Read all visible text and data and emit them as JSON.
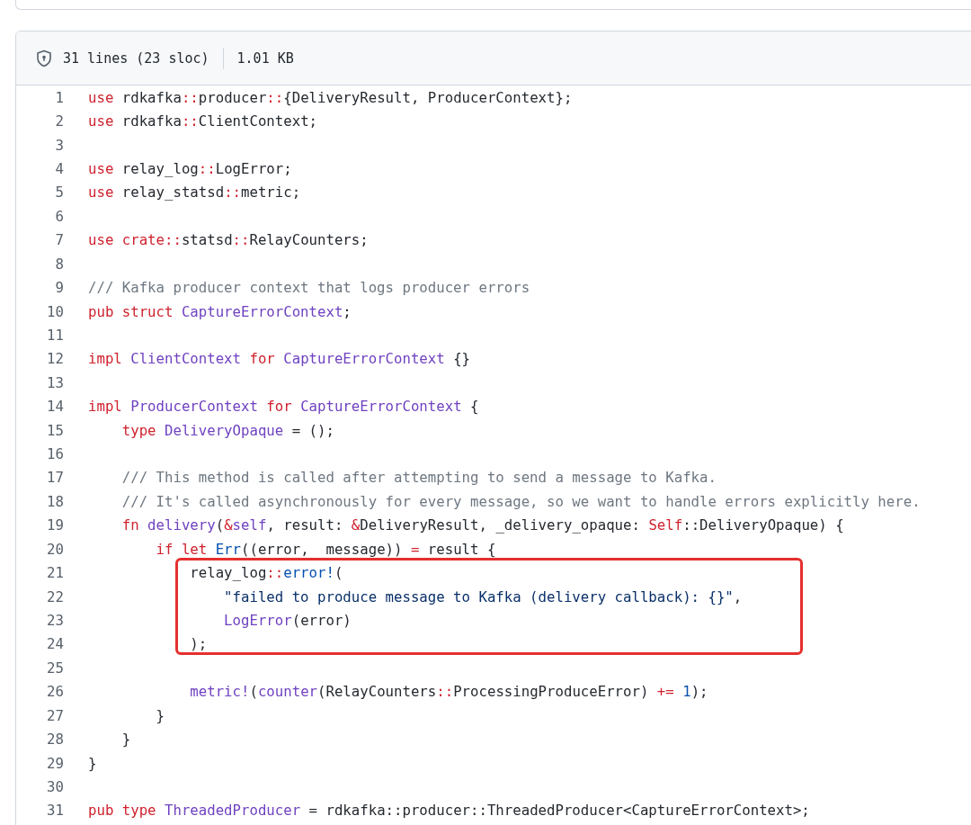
{
  "file_info": {
    "lines": "31 lines (23 sloc)",
    "size": "1.01 KB"
  },
  "code_lines": [
    {
      "number": "1",
      "tokens": [
        {
          "kind": "kw",
          "text": "use"
        },
        {
          "kind": "plain",
          "text": " rdkafka"
        },
        {
          "kind": "op",
          "text": "::"
        },
        {
          "kind": "plain",
          "text": "producer"
        },
        {
          "kind": "op",
          "text": "::"
        },
        {
          "kind": "plain",
          "text": "{DeliveryResult, ProducerContext};"
        }
      ]
    },
    {
      "number": "2",
      "tokens": [
        {
          "kind": "kw",
          "text": "use"
        },
        {
          "kind": "plain",
          "text": " rdkafka"
        },
        {
          "kind": "op",
          "text": "::"
        },
        {
          "kind": "plain",
          "text": "ClientContext;"
        }
      ]
    },
    {
      "number": "3"
    },
    {
      "number": "4",
      "tokens": [
        {
          "kind": "kw",
          "text": "use"
        },
        {
          "kind": "plain",
          "text": " relay_log"
        },
        {
          "kind": "op",
          "text": "::"
        },
        {
          "kind": "plain",
          "text": "LogError;"
        }
      ]
    },
    {
      "number": "5",
      "tokens": [
        {
          "kind": "kw",
          "text": "use"
        },
        {
          "kind": "plain",
          "text": " relay_statsd"
        },
        {
          "kind": "op",
          "text": "::"
        },
        {
          "kind": "plain",
          "text": "metric;"
        }
      ]
    },
    {
      "number": "6"
    },
    {
      "number": "7",
      "tokens": [
        {
          "kind": "kw",
          "text": "use"
        },
        {
          "kind": "kw",
          "text": " crate"
        },
        {
          "kind": "op",
          "text": "::"
        },
        {
          "kind": "plain",
          "text": "statsd"
        },
        {
          "kind": "op",
          "text": "::"
        },
        {
          "kind": "plain",
          "text": "RelayCounters;"
        }
      ]
    },
    {
      "number": "8"
    },
    {
      "number": "9",
      "tokens": [
        {
          "kind": "comment",
          "text": "/// Kafka producer context that logs producer errors"
        }
      ]
    },
    {
      "number": "10",
      "tokens": [
        {
          "kind": "kw",
          "text": "pub struct"
        },
        {
          "kind": "type",
          "text": " CaptureErrorContext"
        },
        {
          "kind": "plain",
          "text": ";"
        }
      ]
    },
    {
      "number": "11"
    },
    {
      "number": "12",
      "tokens": [
        {
          "kind": "kw",
          "text": "impl"
        },
        {
          "kind": "type",
          "text": " ClientContext"
        },
        {
          "kind": "kw",
          "text": " for"
        },
        {
          "kind": "type",
          "text": " CaptureErrorContext"
        },
        {
          "kind": "plain",
          "text": " {}"
        }
      ]
    },
    {
      "number": "13"
    },
    {
      "number": "14",
      "tokens": [
        {
          "kind": "kw",
          "text": "impl"
        },
        {
          "kind": "type",
          "text": " ProducerContext"
        },
        {
          "kind": "kw",
          "text": " for"
        },
        {
          "kind": "type",
          "text": " CaptureErrorContext"
        },
        {
          "kind": "plain",
          "text": " {"
        }
      ]
    },
    {
      "number": "15",
      "tokens": [
        {
          "kind": "kw",
          "text": "    type"
        },
        {
          "kind": "type",
          "text": " DeliveryOpaque"
        },
        {
          "kind": "plain",
          "text": " = ();"
        }
      ]
    },
    {
      "number": "16"
    },
    {
      "number": "17",
      "tokens": [
        {
          "kind": "comment",
          "text": "    /// This method is called after attempting to send a message to Kafka."
        }
      ]
    },
    {
      "number": "18",
      "tokens": [
        {
          "kind": "comment",
          "text": "    /// It's called asynchronously for every message, so we want to handle errors explicitly here."
        }
      ]
    },
    {
      "number": "19",
      "tokens": [
        {
          "kind": "kw",
          "text": "    fn"
        },
        {
          "kind": "type",
          "text": " delivery"
        },
        {
          "kind": "plain",
          "text": "("
        },
        {
          "kind": "op",
          "text": "&"
        },
        {
          "kind": "type",
          "text": "self"
        },
        {
          "kind": "plain",
          "text": ", result: "
        },
        {
          "kind": "op",
          "text": "&"
        },
        {
          "kind": "plain",
          "text": "DeliveryResult, _delivery_opaque: "
        },
        {
          "kind": "kw",
          "text": "Self"
        },
        {
          "kind": "plain",
          "text": "::DeliveryOpaque) {"
        }
      ]
    },
    {
      "number": "20",
      "tokens": [
        {
          "kind": "kw",
          "text": "        if let"
        },
        {
          "kind": "const",
          "text": " Err"
        },
        {
          "kind": "plain",
          "text": "((error,  message)) "
        },
        {
          "kind": "op",
          "text": "="
        },
        {
          "kind": "plain",
          "text": " result {"
        }
      ]
    },
    {
      "number": "21",
      "tokens": [
        {
          "kind": "plain",
          "text": "            relay_log"
        },
        {
          "kind": "op",
          "text": "::"
        },
        {
          "kind": "const",
          "text": "error!"
        },
        {
          "kind": "plain",
          "text": "("
        }
      ]
    },
    {
      "number": "22",
      "tokens": [
        {
          "kind": "string",
          "text": "                \"failed to produce message to Kafka (delivery callback): {}\""
        },
        {
          "kind": "plain",
          "text": ","
        }
      ]
    },
    {
      "number": "23",
      "tokens": [
        {
          "kind": "type",
          "text": "                LogError"
        },
        {
          "kind": "plain",
          "text": "(error)"
        }
      ]
    },
    {
      "number": "24",
      "tokens": [
        {
          "kind": "plain",
          "text": "            );"
        }
      ]
    },
    {
      "number": "25"
    },
    {
      "number": "26",
      "tokens": [
        {
          "kind": "type",
          "text": "            metric!"
        },
        {
          "kind": "plain",
          "text": "("
        },
        {
          "kind": "type",
          "text": "counter"
        },
        {
          "kind": "plain",
          "text": "(RelayCounters"
        },
        {
          "kind": "op",
          "text": "::"
        },
        {
          "kind": "plain",
          "text": "ProcessingProduceError) "
        },
        {
          "kind": "op",
          "text": "+="
        },
        {
          "kind": "const",
          "text": " 1"
        },
        {
          "kind": "plain",
          "text": ");"
        }
      ]
    },
    {
      "number": "27",
      "tokens": [
        {
          "kind": "plain",
          "text": "        }"
        }
      ]
    },
    {
      "number": "28",
      "tokens": [
        {
          "kind": "plain",
          "text": "    }"
        }
      ]
    },
    {
      "number": "29",
      "tokens": [
        {
          "kind": "plain",
          "text": "}"
        }
      ]
    },
    {
      "number": "30"
    },
    {
      "number": "31",
      "tokens": [
        {
          "kind": "kw",
          "text": "pub type"
        },
        {
          "kind": "type",
          "text": " ThreadedProducer"
        },
        {
          "kind": "plain",
          "text": " = rdkafka::producer::ThreadedProducer<CaptureErrorContext>;"
        }
      ]
    }
  ]
}
